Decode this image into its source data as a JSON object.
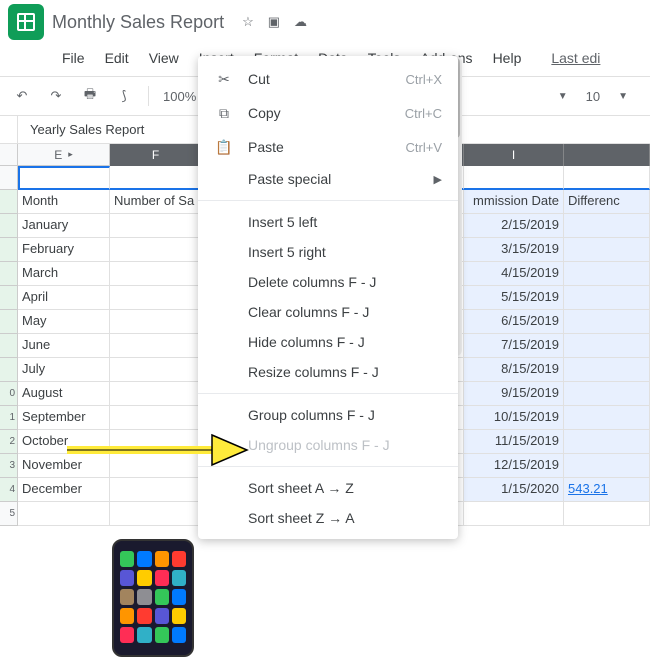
{
  "doc_title": "Monthly Sales Report",
  "menubar": [
    "File",
    "Edit",
    "View",
    "Insert",
    "Format",
    "Data",
    "Tools",
    "Add-ons",
    "Help"
  ],
  "last_edit": "Last edi",
  "toolbar": {
    "zoom": "100%",
    "font_size": "10"
  },
  "tab_name": "Yearly Sales Report",
  "col_headers": {
    "E": "E",
    "F": "F",
    "I": "I"
  },
  "header_row": {
    "month": "Month",
    "num_sales": "Number of Sa",
    "commission": "mmission Date",
    "diff": "Differenc"
  },
  "rows": [
    {
      "n": "",
      "month": "January",
      "date": "2/15/2019",
      "diff": ""
    },
    {
      "n": "",
      "month": "February",
      "date": "3/15/2019",
      "diff": ""
    },
    {
      "n": "",
      "month": "March",
      "date": "4/15/2019",
      "diff": ""
    },
    {
      "n": "",
      "month": "April",
      "date": "5/15/2019",
      "diff": ""
    },
    {
      "n": "",
      "month": "May",
      "date": "6/15/2019",
      "diff": ""
    },
    {
      "n": "",
      "month": "June",
      "date": "7/15/2019",
      "diff": ""
    },
    {
      "n": "",
      "month": "July",
      "date": "8/15/2019",
      "diff": ""
    },
    {
      "n": "0",
      "month": "August",
      "date": "9/15/2019",
      "diff": ""
    },
    {
      "n": "1",
      "month": "September",
      "date": "10/15/2019",
      "diff": ""
    },
    {
      "n": "2",
      "month": "October",
      "date": "11/15/2019",
      "diff": ""
    },
    {
      "n": "3",
      "month": "November",
      "date": "12/15/2019",
      "diff": ""
    },
    {
      "n": "4",
      "month": "December",
      "date": "1/15/2020",
      "diff": "543.21"
    }
  ],
  "context_menu": {
    "cut": "Cut",
    "cut_k": "Ctrl+X",
    "copy": "Copy",
    "copy_k": "Ctrl+C",
    "paste": "Paste",
    "paste_k": "Ctrl+V",
    "paste_special": "Paste special",
    "insert_left": "Insert 5 left",
    "insert_right": "Insert 5 right",
    "delete": "Delete columns F - J",
    "clear": "Clear columns F - J",
    "hide": "Hide columns F - J",
    "resize": "Resize columns F - J",
    "group": "Group columns F - J",
    "ungroup": "Ungroup columns F - J",
    "sort_az": "Sort sheet A → Z",
    "sort_za": "Sort sheet Z → A"
  }
}
